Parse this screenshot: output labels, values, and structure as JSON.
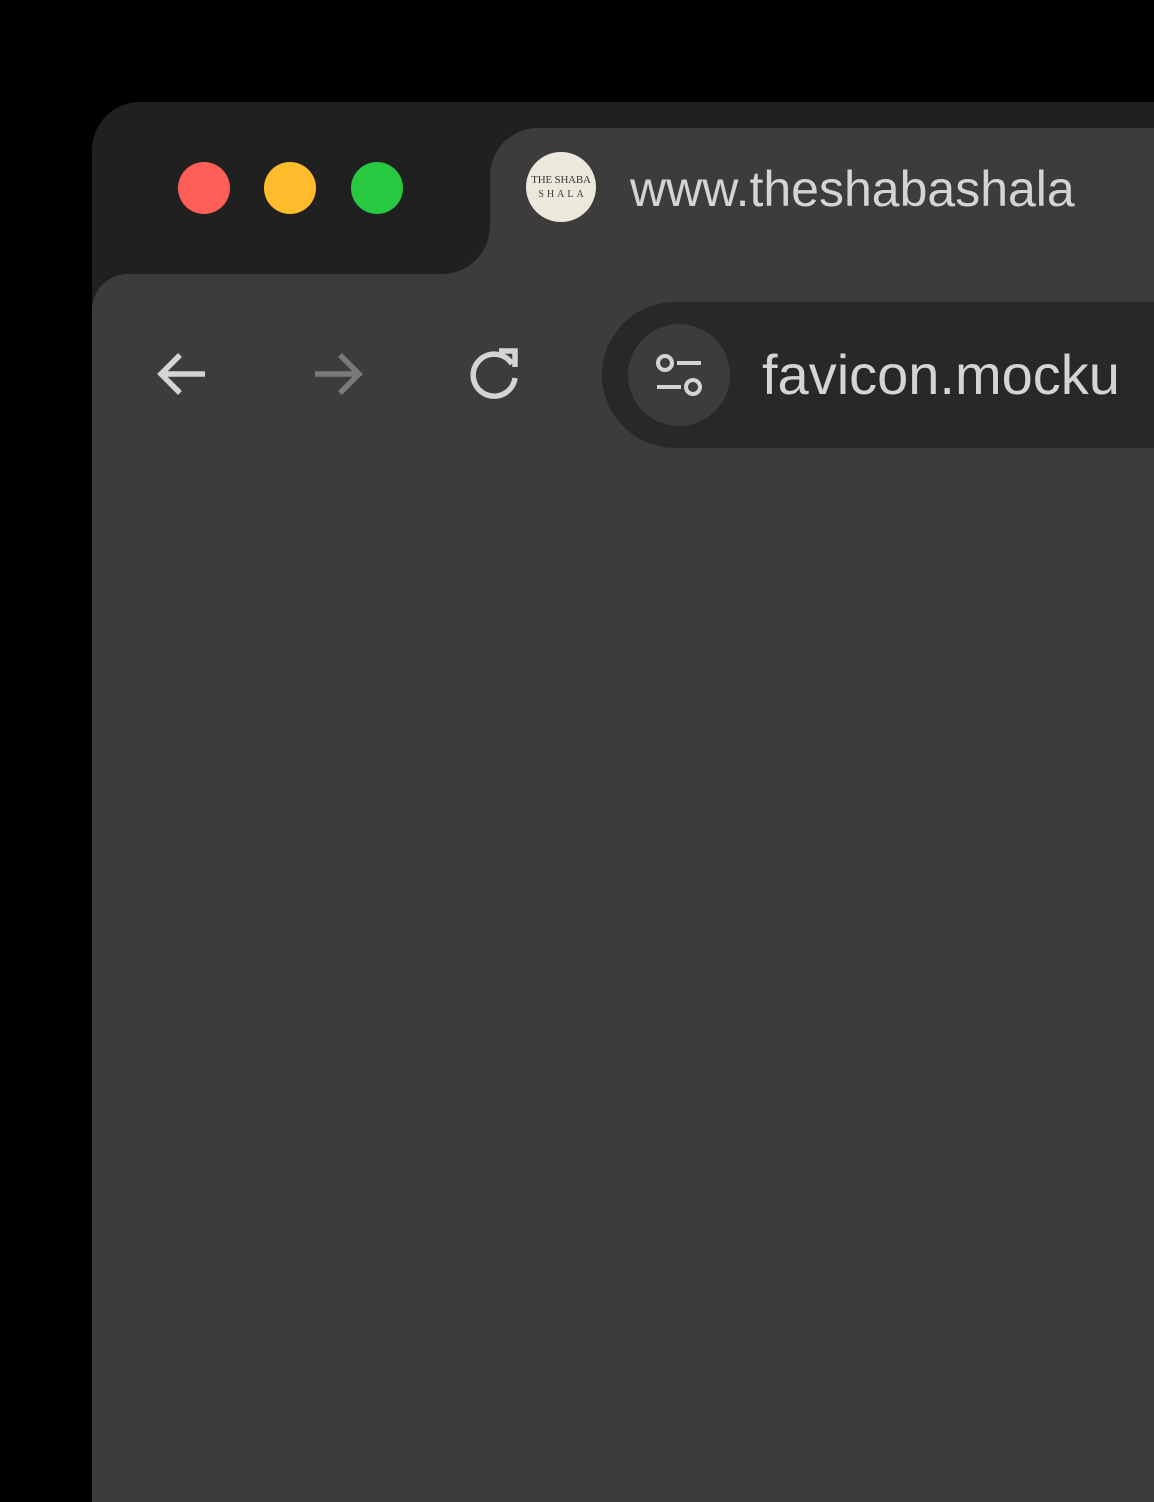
{
  "window": {
    "controls": [
      {
        "name": "close",
        "color": "#ff5f57"
      },
      {
        "name": "minimize",
        "color": "#ffbd2e"
      },
      {
        "name": "zoom",
        "color": "#28c840"
      }
    ]
  },
  "tab": {
    "favicon": {
      "line1": "THE SHABA",
      "line2": "SHALA"
    },
    "title": "www.theshabashala"
  },
  "toolbar": {
    "back_icon": "arrow-left-icon",
    "forward_icon": "arrow-right-icon",
    "reload_icon": "reload-icon",
    "site_info_icon": "tune-icon",
    "url": "favicon.mocku"
  },
  "colors": {
    "frame": "#202020",
    "toolbar": "#3c3c3c",
    "omnibox": "#282828",
    "text": "#d4d4d4"
  }
}
